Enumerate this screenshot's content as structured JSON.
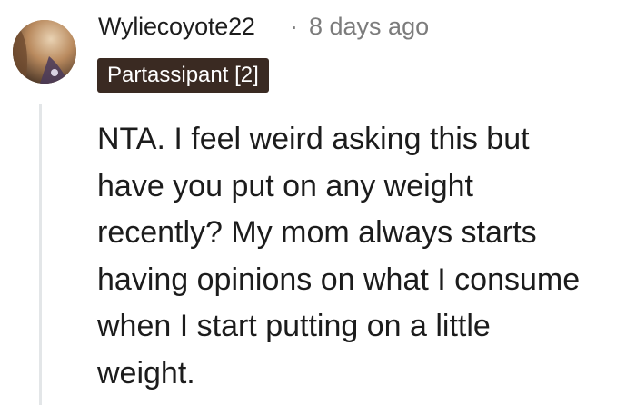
{
  "comment": {
    "author": "Wyliecoyote22",
    "separator": "·",
    "timestamp": "8 days ago",
    "flair": "Partassipant [2]",
    "body": "NTA. I feel weird asking this but\nhave you put on any weight\nrecently? My mom always starts\nhaving opinions on what I consume\nwhen I start putting on a little\nweight."
  },
  "colors": {
    "flair_background": "#3a2a22",
    "thread_line": "#e3e6e8",
    "meta_text": "#7c7c7c"
  },
  "icons": {
    "avatar": "user-avatar-photo"
  }
}
